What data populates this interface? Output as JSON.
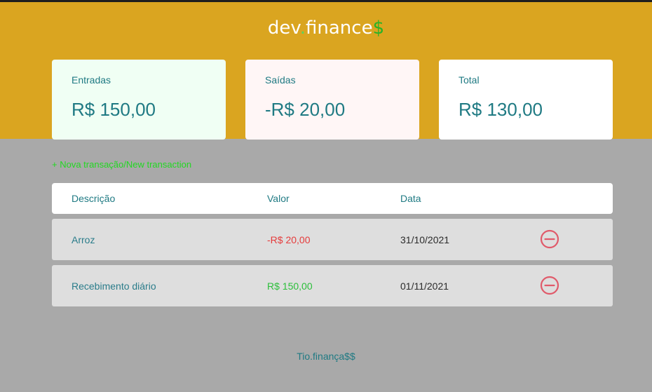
{
  "header": {
    "logo_main": "dev",
    "logo_dot": ".",
    "logo_word": "finance",
    "logo_symbol": "$"
  },
  "balance": {
    "income": {
      "label": "Entradas",
      "value": "R$ 150,00"
    },
    "expense": {
      "label": "Saídas",
      "value": "-R$ 20,00"
    },
    "total": {
      "label": "Total",
      "value": "R$ 130,00"
    }
  },
  "actions": {
    "new_transaction": "+ Nova transação/New transaction"
  },
  "table": {
    "headers": {
      "description": "Descrição",
      "amount": "Valor",
      "date": "Data"
    },
    "rows": [
      {
        "description": "Arroz",
        "amount": "-R$ 20,00",
        "date": "31/10/2021",
        "type": "expense",
        "action_icon": "minus-circle-icon"
      },
      {
        "description": "Recebimento diário",
        "amount": "R$ 150,00",
        "date": "01/11/2021",
        "type": "income",
        "action_icon": "minus-circle-icon"
      }
    ]
  },
  "footer": {
    "text": "Tio.finança$$"
  },
  "colors": {
    "header_bg": "#daa520",
    "page_bg": "#a9a9a9",
    "accent_teal": "#1f7a83",
    "income_green": "#2bbf3a",
    "expense_red": "#e53b3b",
    "remove_icon": "#e05a6a",
    "link_green": "#22d822"
  }
}
